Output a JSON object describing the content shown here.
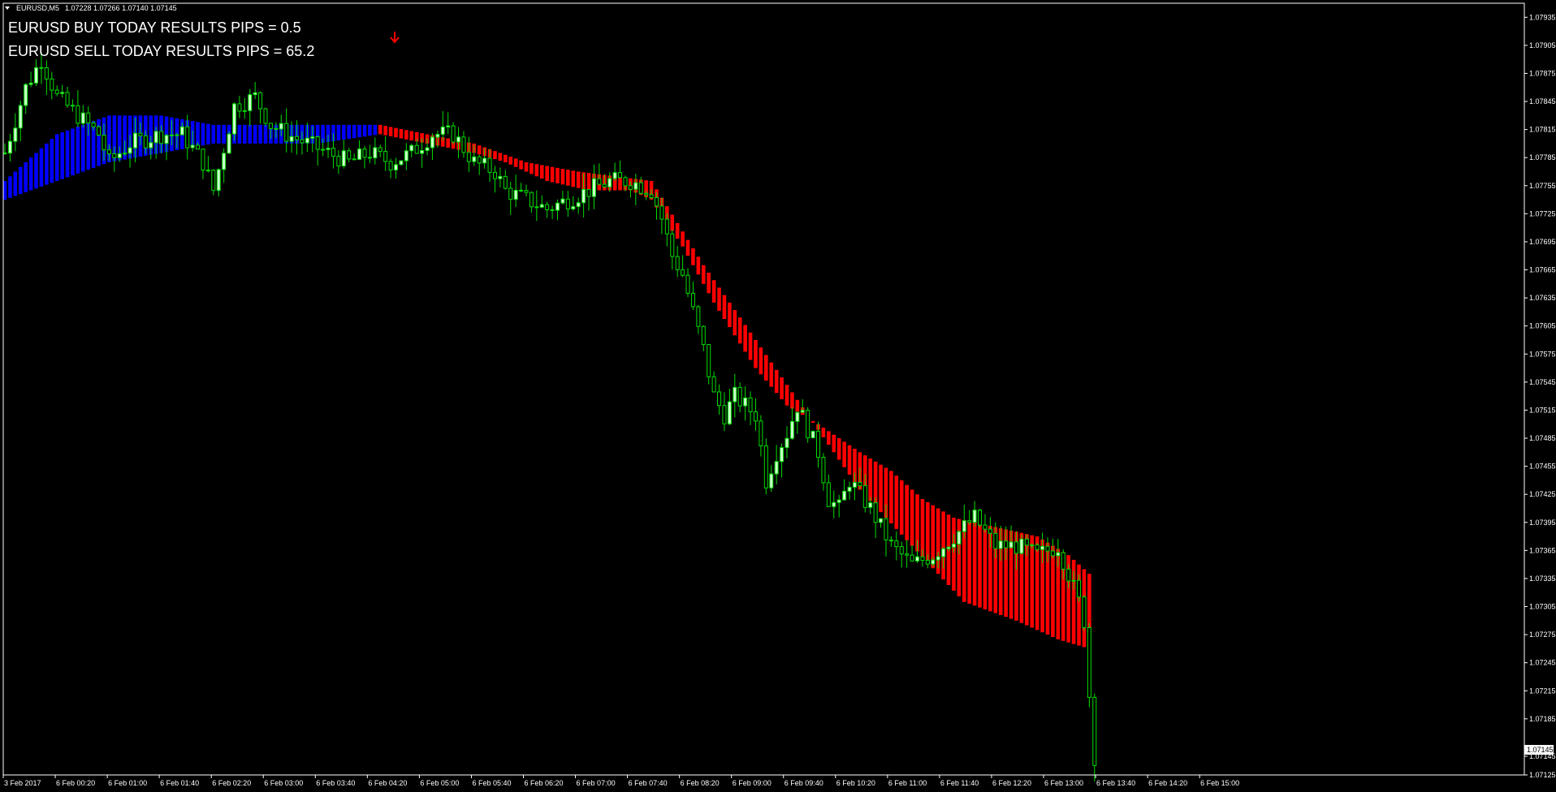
{
  "window": {
    "symbol_timeframe": "EURUSD,M5",
    "ohlc": "1.07228 1.07266 1.07140 1.07145",
    "menu_arrow_icon": "triangle-down-icon"
  },
  "indicator_text": {
    "buy_line": "EURUSD BUY TODAY RESULTS PIPS = 0.5",
    "sell_line": "EURUSD SELL TODAY RESULTS PIPS = 65.2",
    "signal_icon": "sell-arrow-down-icon"
  },
  "colors": {
    "background": "#000000",
    "axis": "#ffffff",
    "candle_bull_fill": "#ccffcc",
    "candle_bear_fill": "#000000",
    "candle_outline": "#00dd00",
    "ribbon_up": "#0000ff",
    "ribbon_down": "#ff0000",
    "text": "#ffffff",
    "signal_arrow": "#ff0000",
    "price_tag_bg": "#ffffff",
    "price_tag_text": "#000000"
  },
  "chart_data": {
    "type": "candlestick",
    "ylim": [
      1.07125,
      1.0795
    ],
    "current_price": "1.07145",
    "y_tick_labels": [
      "1.07935",
      "1.07905",
      "1.07875",
      "1.07845",
      "1.07815",
      "1.07785",
      "1.07755",
      "1.07725",
      "1.07695",
      "1.07665",
      "1.07635",
      "1.07605",
      "1.07575",
      "1.07545",
      "1.07515",
      "1.07485",
      "1.07455",
      "1.07425",
      "1.07395",
      "1.07365",
      "1.07335",
      "1.07305",
      "1.07275",
      "1.07245",
      "1.07215",
      "1.07185",
      "1.07145",
      "1.07125"
    ],
    "x_tick_labels": [
      "3 Feb 2017",
      "6 Feb 00:20",
      "6 Feb 01:00",
      "6 Feb 01:40",
      "6 Feb 02:20",
      "6 Feb 03:00",
      "6 Feb 03:40",
      "6 Feb 04:20",
      "6 Feb 05:00",
      "6 Feb 05:40",
      "6 Feb 06:20",
      "6 Feb 07:00",
      "6 Feb 07:40",
      "6 Feb 08:20",
      "6 Feb 09:00",
      "6 Feb 09:40",
      "6 Feb 10:20",
      "6 Feb 11:00",
      "6 Feb 11:40",
      "6 Feb 12:20",
      "6 Feb 13:00",
      "6 Feb 13:40",
      "6 Feb 14:20",
      "6 Feb 15:00"
    ],
    "close_series": [
      [
        0,
        1.0779
      ],
      [
        4,
        1.0786
      ],
      [
        7,
        1.0789
      ],
      [
        10,
        1.0785
      ],
      [
        14,
        1.0783
      ],
      [
        18,
        1.0781
      ],
      [
        20,
        1.0778
      ],
      [
        24,
        1.078
      ],
      [
        30,
        1.0781
      ],
      [
        34,
        1.0781
      ],
      [
        38,
        1.0778
      ],
      [
        40,
        1.0775
      ],
      [
        44,
        1.0784
      ],
      [
        48,
        1.0785
      ],
      [
        51,
        1.0782
      ],
      [
        54,
        1.0781
      ],
      [
        58,
        1.078
      ],
      [
        62,
        1.0779
      ],
      [
        66,
        1.0778
      ],
      [
        70,
        1.0779
      ],
      [
        74,
        1.0778
      ],
      [
        78,
        1.0779
      ],
      [
        82,
        1.0781
      ],
      [
        86,
        1.0781
      ],
      [
        90,
        1.0778
      ],
      [
        94,
        1.0777
      ],
      [
        96,
        1.0775
      ],
      [
        100,
        1.0774
      ],
      [
        104,
        1.0773
      ],
      [
        108,
        1.0774
      ],
      [
        112,
        1.0775
      ],
      [
        116,
        1.0776
      ],
      [
        120,
        1.0776
      ],
      [
        124,
        1.0775
      ],
      [
        126,
        1.0772
      ],
      [
        128,
        1.0768
      ],
      [
        130,
        1.0766
      ],
      [
        132,
        1.0762
      ],
      [
        134,
        1.0758
      ],
      [
        136,
        1.0753
      ],
      [
        138,
        1.0751
      ],
      [
        140,
        1.0753
      ],
      [
        144,
        1.0751
      ],
      [
        146,
        1.0744
      ],
      [
        148,
        1.0747
      ],
      [
        150,
        1.0749
      ],
      [
        152,
        1.0752
      ],
      [
        156,
        1.0747
      ],
      [
        158,
        1.0742
      ],
      [
        160,
        1.0741
      ],
      [
        162,
        1.0744
      ],
      [
        166,
        1.0741
      ],
      [
        170,
        1.0737
      ],
      [
        174,
        1.0735
      ],
      [
        178,
        1.0736
      ],
      [
        182,
        1.0738
      ],
      [
        186,
        1.074
      ],
      [
        190,
        1.0737
      ],
      [
        194,
        1.0737
      ],
      [
        198,
        1.0736
      ],
      [
        202,
        1.0737
      ],
      [
        204,
        1.0734
      ],
      [
        206,
        1.0731
      ],
      [
        207,
        1.0729
      ],
      [
        208,
        1.0721
      ],
      [
        209,
        1.07145
      ]
    ],
    "ribbon": {
      "up_until_bar": 72,
      "upper": [
        [
          0,
          1.0776
        ],
        [
          10,
          1.0781
        ],
        [
          20,
          1.0783
        ],
        [
          30,
          1.0783
        ],
        [
          40,
          1.0782
        ],
        [
          50,
          1.0782
        ],
        [
          60,
          1.0782
        ],
        [
          72,
          1.0782
        ],
        [
          90,
          1.078
        ],
        [
          100,
          1.0778
        ],
        [
          110,
          1.0777
        ],
        [
          124,
          1.0776
        ],
        [
          134,
          1.0767
        ],
        [
          144,
          1.0759
        ],
        [
          154,
          1.0751
        ],
        [
          164,
          1.0743
        ],
        [
          174,
          1.0737
        ],
        [
          184,
          1.0731
        ],
        [
          194,
          1.0729
        ],
        [
          202,
          1.0727
        ],
        [
          208,
          1.0726
        ]
      ],
      "lower": [
        [
          0,
          1.0774
        ],
        [
          10,
          1.0776
        ],
        [
          20,
          1.0778
        ],
        [
          30,
          1.0779
        ],
        [
          40,
          1.078
        ],
        [
          50,
          1.078
        ],
        [
          60,
          1.078
        ],
        [
          72,
          1.0781
        ],
        [
          90,
          1.0779
        ],
        [
          96,
          1.0778
        ],
        [
          104,
          1.0776
        ],
        [
          112,
          1.0775
        ],
        [
          120,
          1.0775
        ],
        [
          124,
          1.0774
        ],
        [
          130,
          1.0769
        ],
        [
          136,
          1.0763
        ],
        [
          144,
          1.0756
        ],
        [
          150,
          1.0752
        ],
        [
          156,
          1.075
        ],
        [
          164,
          1.0747
        ],
        [
          170,
          1.0745
        ],
        [
          176,
          1.0742
        ],
        [
          182,
          1.074
        ],
        [
          190,
          1.0739
        ],
        [
          198,
          1.0738
        ],
        [
          204,
          1.0736
        ],
        [
          208,
          1.0734
        ]
      ]
    }
  }
}
